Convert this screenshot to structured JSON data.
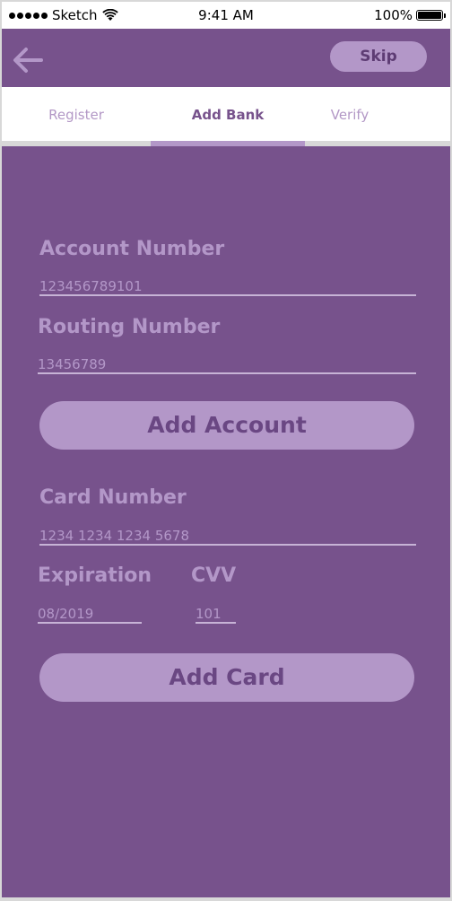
{
  "status_bar": {
    "carrier": "Sketch",
    "time": "9:41 AM",
    "battery": "100%",
    "battery_level": 1.0
  },
  "nav": {
    "back_icon": "arrow-left-icon",
    "skip_label": "Skip"
  },
  "tabs": [
    {
      "label": "Register",
      "active": false
    },
    {
      "label": "Add Bank",
      "active": true
    },
    {
      "label": "Verify",
      "active": false
    }
  ],
  "form": {
    "account_number": {
      "label": "Account Number",
      "value": "123456789101"
    },
    "routing_number": {
      "label": "Routing Number",
      "value": "13456789"
    },
    "add_account_label": "Add Account",
    "card_number": {
      "label": "Card Number",
      "value": "1234 1234 1234 5678"
    },
    "expiration": {
      "label": "Expiration",
      "value": "08/2019"
    },
    "cvv": {
      "label": "CVV",
      "value": "101"
    },
    "add_card_label": "Add Card"
  },
  "colors": {
    "background": "#77528c",
    "accent": "#b397c8",
    "tab_bar": "#ffffff"
  }
}
